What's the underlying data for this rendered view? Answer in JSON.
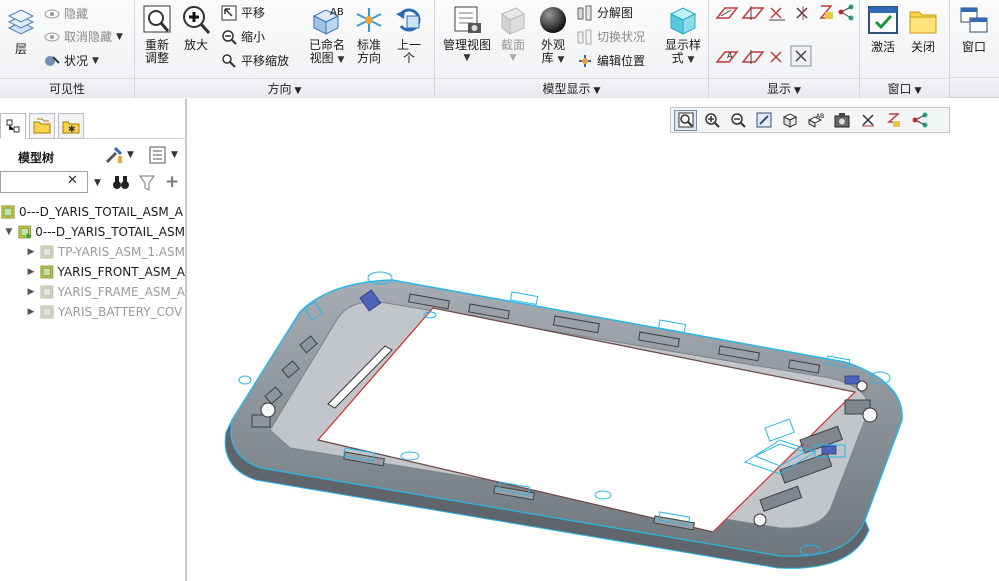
{
  "ribbon": {
    "visibility": {
      "label": "可见性",
      "layer": "层",
      "hide": "隐藏",
      "unhide": "取消隐藏",
      "status": "状况"
    },
    "orientation": {
      "label": "方向",
      "refit": "重新\n调整",
      "zoom_in": "放大",
      "pan": "平移",
      "zoom_out": "缩小",
      "pan_zoom": "平移缩放",
      "saved_views": "已命名\n视图",
      "standard_orientation": "标准\n方向",
      "previous": "上一\n个"
    },
    "model_display": {
      "label": "模型显示",
      "manage_views": "管理视图",
      "section": "截面",
      "appearance": "外观\n库",
      "exploded_view": "分解图",
      "toggle_status": "切换状况",
      "edit_position": "编辑位置",
      "display_style": "显示样\n式"
    },
    "show": {
      "label": "显示"
    },
    "window": {
      "label": "窗口",
      "activate": "激活",
      "close": "关闭",
      "windows": "窗口"
    }
  },
  "sidebar": {
    "tree_title": "模型树",
    "filter_placeholder": "",
    "tree": [
      {
        "label": "0---D_YARIS_TOTAIL_ASM_A",
        "state": "normal"
      },
      {
        "label": "0---D_YARIS_TOTAIL_ASM",
        "state": "normal"
      },
      {
        "label": "TP-YARIS_ASM_1.ASM",
        "state": "greyed"
      },
      {
        "label": "YARIS_FRONT_ASM_A",
        "state": "normal"
      },
      {
        "label": "YARIS_FRAME_ASM_A",
        "state": "greyed"
      },
      {
        "label": "YARIS_BATTERY_COV",
        "state": "greyed"
      }
    ]
  },
  "colors": {
    "accent": "#2a6fc9",
    "model_body": "#8d949b",
    "model_edge": "#29b6e6",
    "datum_red": "#d42a2a"
  },
  "view_toolbar_icons": [
    "refit-icon",
    "zoom-in-icon",
    "zoom-out-icon",
    "repaint-icon",
    "orientation-cube-icon",
    "saved-views-icon",
    "display-style-icon",
    "datum-axes-icon",
    "datum-points-icon",
    "datum-csys-icon"
  ]
}
